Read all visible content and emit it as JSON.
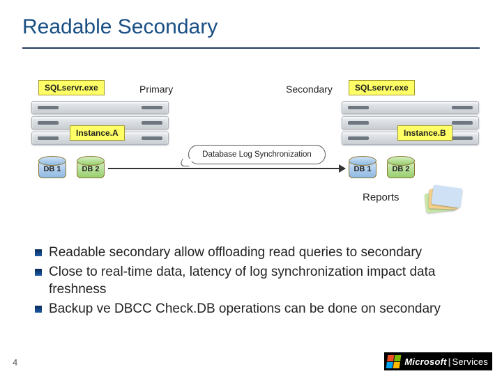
{
  "title": "Readable Secondary",
  "diagram": {
    "sql_label": "SQLservr.exe",
    "instanceA": "Instance.A",
    "instanceB": "Instance.B",
    "primary": "Primary",
    "secondary": "Secondary",
    "db1": "DB 1",
    "db2": "DB 2",
    "sync_label": "Database Log Synchronization",
    "reports": "Reports"
  },
  "bullets": [
    "Readable secondary allow offloading read queries to secondary",
    "Close to real-time data, latency of log synchronization impact data freshness",
    "Backup ve DBCC Check.DB operations can be done on secondary"
  ],
  "page_number": "4",
  "brand": {
    "company": "Microsoft",
    "unit": "Services"
  }
}
